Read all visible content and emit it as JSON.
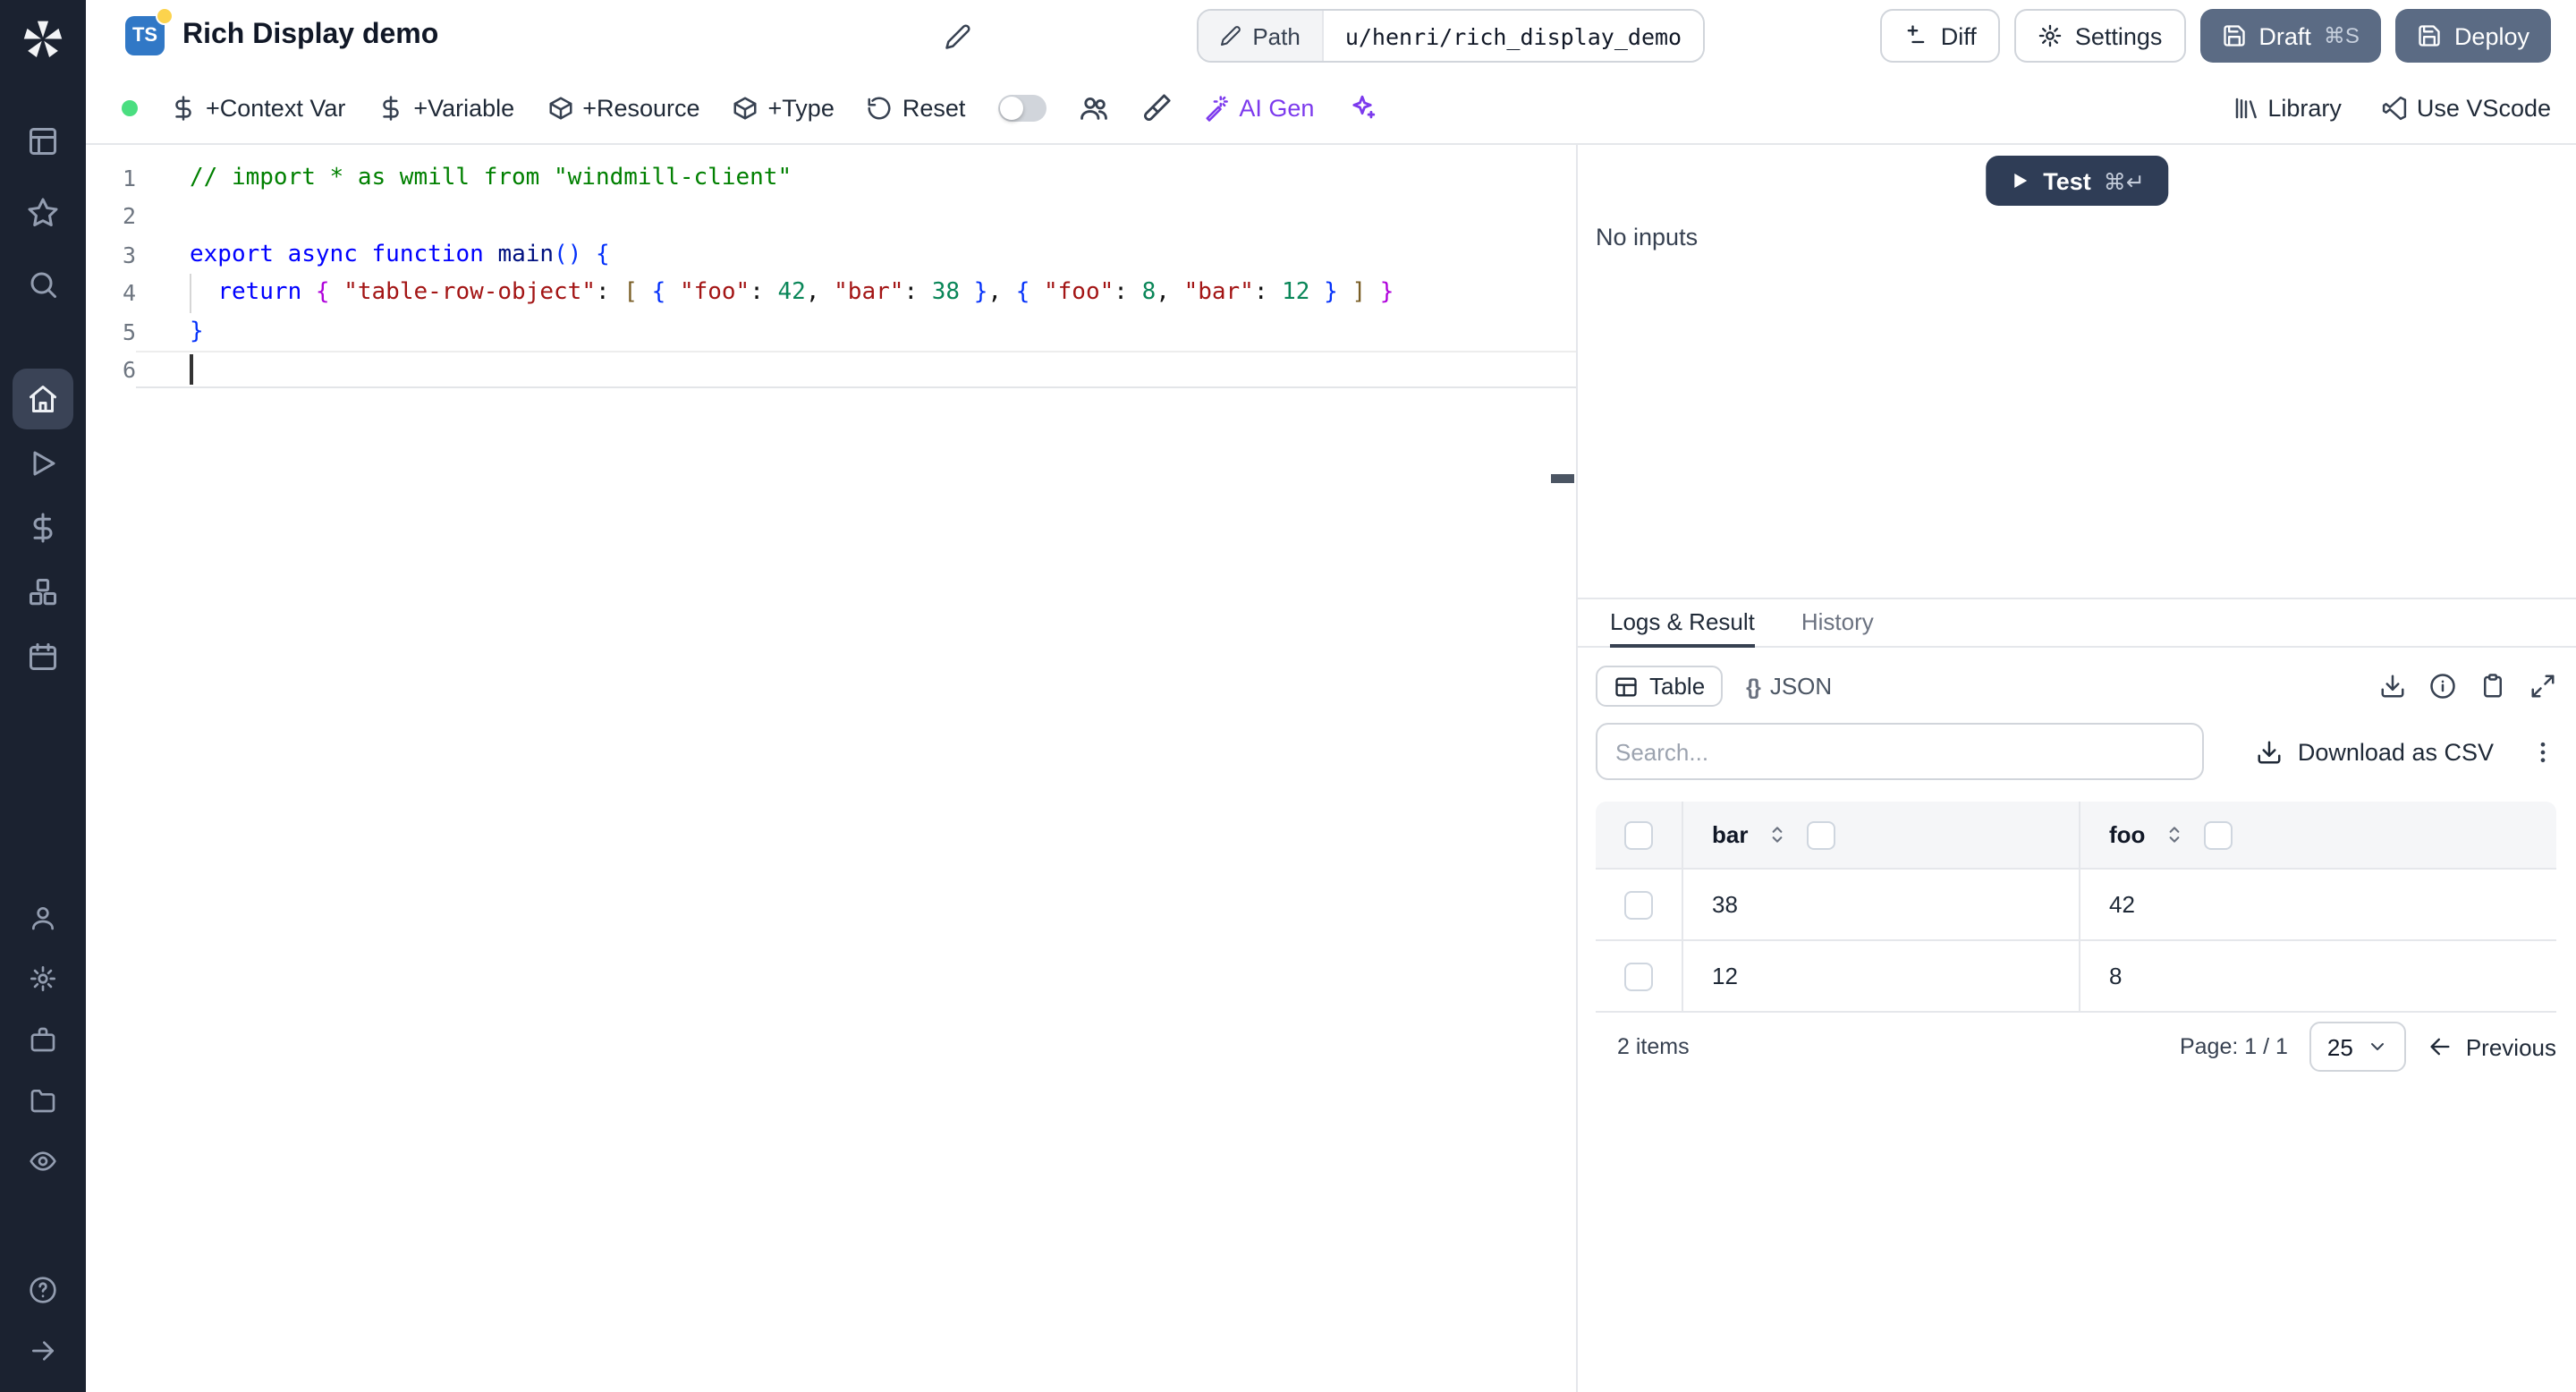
{
  "colors": {
    "sidebar_bg": "#1b2230",
    "sidebar_active_bg": "#3a4356",
    "primary_btn": "#5b6b84",
    "test_btn": "#2f3d56",
    "ts_badge": "#3178c6",
    "status_green": "#4ade80",
    "ai_accent": "#7c3aed",
    "tab_active_underline": "#374151"
  },
  "sidebar": {
    "icons": [
      "windmill-logo",
      "apps",
      "favorites",
      "search",
      "home",
      "runs",
      "variables",
      "resources",
      "schedules",
      "user",
      "settings",
      "workers",
      "folders",
      "audit-logs",
      "help",
      "expand-sidebar"
    ],
    "active": "home"
  },
  "header": {
    "lang_badge": "TS",
    "title": "Rich Display demo",
    "path_label": "Path",
    "path_value": "u/henri/rich_display_demo",
    "diff": "Diff",
    "settings": "Settings",
    "draft": "Draft",
    "draft_shortcut": "⌘S",
    "deploy": "Deploy"
  },
  "toolbar": {
    "context_var": "+Context Var",
    "variable": "+Variable",
    "resource": "+Resource",
    "type": "+Type",
    "reset": "Reset",
    "ai_gen": "AI Gen",
    "library": "Library",
    "use_vscode": "Use VScode"
  },
  "editor": {
    "language": "typescript",
    "lines": [
      {
        "num": "1",
        "tokens": [
          [
            "// import * as wmill from \"windmill-client\"",
            "comment"
          ]
        ]
      },
      {
        "num": "2",
        "tokens": []
      },
      {
        "num": "3",
        "tokens": [
          [
            "export",
            "kw"
          ],
          [
            " ",
            "pl"
          ],
          [
            "async",
            "kw"
          ],
          [
            " ",
            "pl"
          ],
          [
            "function",
            "kw"
          ],
          [
            " ",
            "pl"
          ],
          [
            "main",
            "fn"
          ],
          [
            "(",
            "b1"
          ],
          [
            ")",
            "b1"
          ],
          [
            " ",
            "pl"
          ],
          [
            "{",
            "b1"
          ]
        ]
      },
      {
        "num": "4",
        "guide": true,
        "tokens": [
          [
            "  ",
            "pl"
          ],
          [
            "return",
            "kw"
          ],
          [
            " ",
            "pl"
          ],
          [
            "{",
            "b2"
          ],
          [
            " ",
            "pl"
          ],
          [
            "\"table-row-object\"",
            "str"
          ],
          [
            ": ",
            "pl"
          ],
          [
            "[",
            "b3"
          ],
          [
            " ",
            "pl"
          ],
          [
            "{",
            "b1"
          ],
          [
            " ",
            "pl"
          ],
          [
            "\"foo\"",
            "str"
          ],
          [
            ": ",
            "pl"
          ],
          [
            "42",
            "num"
          ],
          [
            ", ",
            "pl"
          ],
          [
            "\"bar\"",
            "str"
          ],
          [
            ": ",
            "pl"
          ],
          [
            "38",
            "num"
          ],
          [
            " ",
            "pl"
          ],
          [
            "}",
            "b1"
          ],
          [
            ", ",
            "pl"
          ],
          [
            "{",
            "b1"
          ],
          [
            " ",
            "pl"
          ],
          [
            "\"foo\"",
            "str"
          ],
          [
            ": ",
            "pl"
          ],
          [
            "8",
            "num"
          ],
          [
            ", ",
            "pl"
          ],
          [
            "\"bar\"",
            "str"
          ],
          [
            ": ",
            "pl"
          ],
          [
            "12",
            "num"
          ],
          [
            " ",
            "pl"
          ],
          [
            "}",
            "b1"
          ],
          [
            " ",
            "pl"
          ],
          [
            "]",
            "b3"
          ],
          [
            " ",
            "pl"
          ],
          [
            "}",
            "b2"
          ]
        ]
      },
      {
        "num": "5",
        "tokens": [
          [
            "}",
            "b1"
          ]
        ]
      },
      {
        "num": "6",
        "current": true,
        "tokens": []
      }
    ]
  },
  "run": {
    "test": "Test",
    "test_shortcut": "⌘↵",
    "no_inputs": "No inputs"
  },
  "result": {
    "tabs": [
      {
        "label": "Logs & Result",
        "active": true
      },
      {
        "label": "History",
        "active": false
      }
    ],
    "view_table": "Table",
    "view_json": "JSON",
    "json_braces": "{}",
    "search_placeholder": "Search...",
    "download_csv": "Download as CSV",
    "table": {
      "columns": [
        "bar",
        "foo"
      ],
      "rows": [
        [
          "38",
          "42"
        ],
        [
          "12",
          "8"
        ]
      ],
      "items_count": "2 items",
      "page": "Page: 1 / 1",
      "page_size": "25",
      "previous": "Previous"
    }
  }
}
